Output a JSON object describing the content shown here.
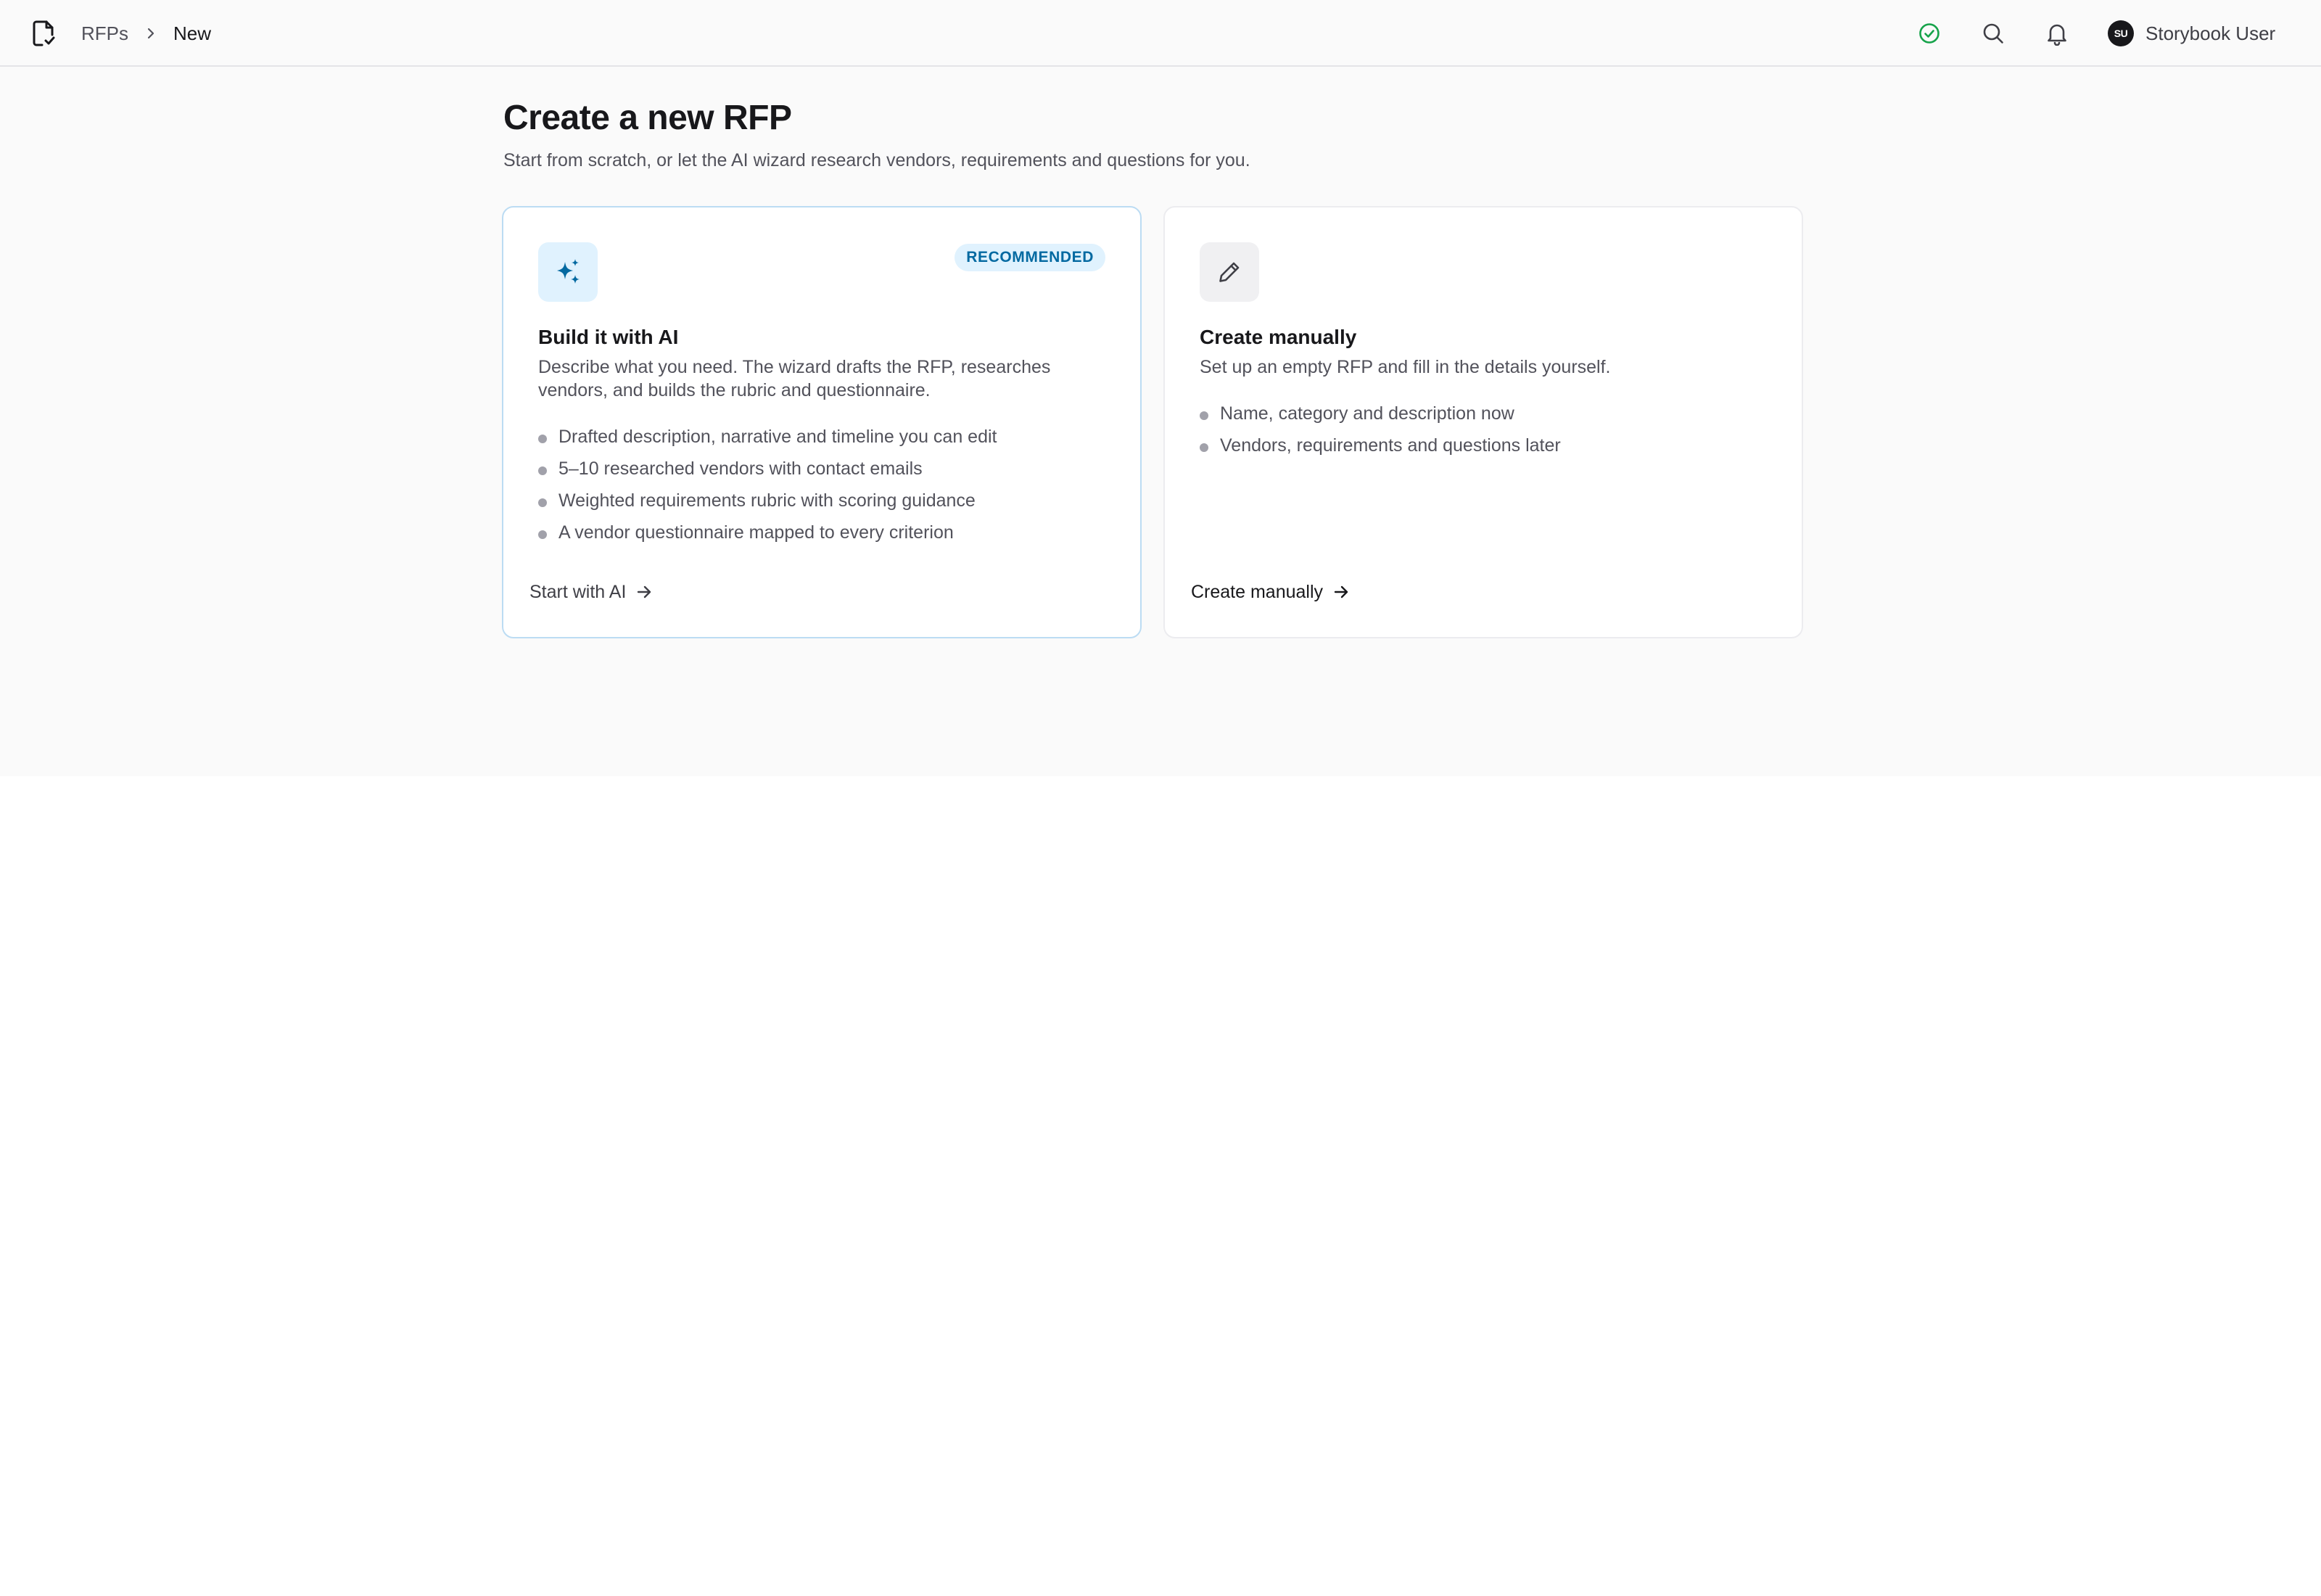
{
  "breadcrumb": {
    "items": [
      "RFPs",
      "New"
    ]
  },
  "header_actions": {
    "status_icon": "check-circle-icon",
    "search_icon": "search-icon",
    "notifications_icon": "bell-icon",
    "user": {
      "initials": "SU",
      "name": "Storybook User"
    }
  },
  "page": {
    "title": "Create a new RFP",
    "subtitle": "Start from scratch, or let the AI wizard research vendors, requirements and questions for you."
  },
  "cards": [
    {
      "icon": "sparkles-icon",
      "badge": "RECOMMENDED",
      "title": "Build it with AI",
      "description": "Describe what you need. The wizard drafts the RFP, researches vendors, and builds the rubric and questionnaire.",
      "features": [
        "Drafted description, narrative and timeline you can edit",
        "5–10 researched vendors with contact emails",
        "Weighted requirements rubric with scoring guidance",
        "A vendor questionnaire mapped to every criterion"
      ],
      "action": "Start with AI"
    },
    {
      "icon": "pencil-icon",
      "title": "Create manually",
      "description": "Set up an empty RFP and fill in the details yourself.",
      "features": [
        "Name, category and description now",
        "Vendors, requirements and questions later"
      ],
      "action": "Create manually"
    }
  ],
  "colors": {
    "accent": "#0369a1",
    "accent_bg": "#e0f2fe",
    "success": "#16a34a",
    "page_bg": "#fafafa"
  }
}
